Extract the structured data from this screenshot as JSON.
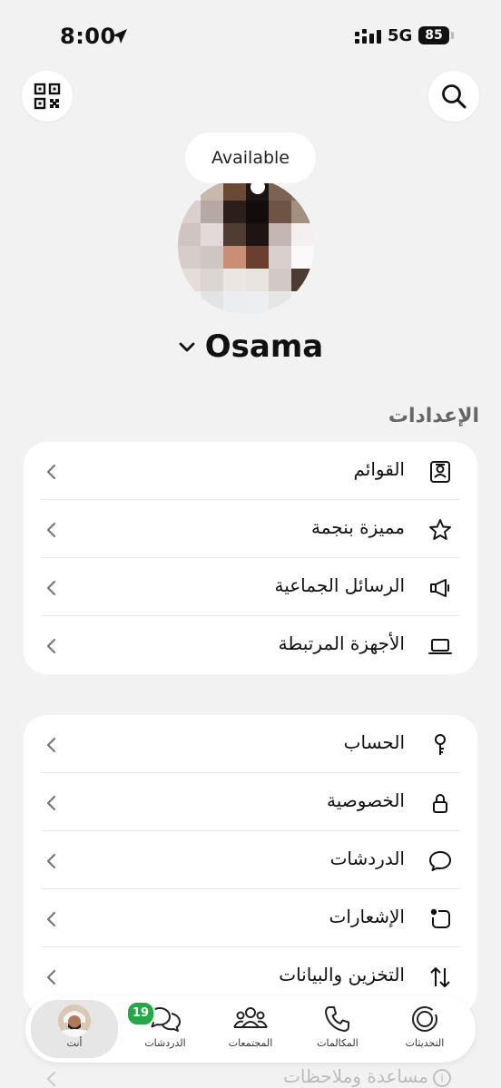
{
  "status_bar": {
    "time": "8:00",
    "network": "5G",
    "battery": "85"
  },
  "header": {
    "qr_icon": "qr-code-icon",
    "search_icon": "search-icon"
  },
  "profile": {
    "status": "Available",
    "name": "Osama"
  },
  "section": {
    "title": "الإعدادات"
  },
  "card1": [
    {
      "label": "القوائم",
      "icon": "lists-icon"
    },
    {
      "label": "مميزة بنجمة",
      "icon": "star-icon"
    },
    {
      "label": "الرسائل الجماعية",
      "icon": "broadcast-icon"
    },
    {
      "label": "الأجهزة المرتبطة",
      "icon": "laptop-icon"
    }
  ],
  "card2": [
    {
      "label": "الحساب",
      "icon": "key-icon"
    },
    {
      "label": "الخصوصية",
      "icon": "lock-icon"
    },
    {
      "label": "الدردشات",
      "icon": "chat-bubble-icon"
    },
    {
      "label": "الإشعارات",
      "icon": "notification-icon"
    },
    {
      "label": "التخزين والبيانات",
      "icon": "transfer-icon"
    }
  ],
  "peek": {
    "label": "مساعدة وملاحظات"
  },
  "tabs": {
    "updates": "التحديثات",
    "calls": "المكالمات",
    "communities": "المجتمعات",
    "chats": "الدردشات",
    "you": "أنت",
    "chats_badge": "19"
  },
  "colors": {
    "background": "#f2f2f2",
    "badge": "#25a845"
  }
}
